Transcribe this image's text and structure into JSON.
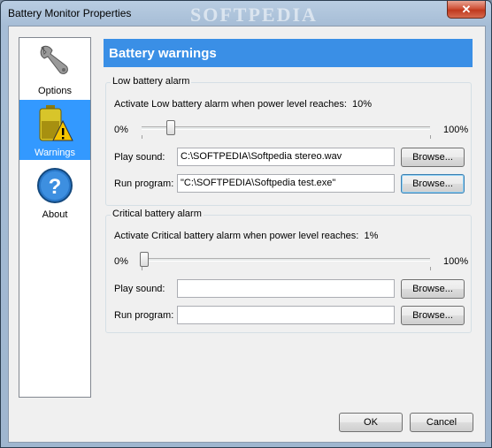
{
  "window": {
    "title": "Battery Monitor Properties",
    "close_glyph": "✕"
  },
  "watermark": "SOFTPEDIA",
  "sidebar": {
    "items": [
      {
        "label": "Options",
        "icon": "wrench-icon",
        "selected": false
      },
      {
        "label": "Warnings",
        "icon": "battery-warning-icon",
        "selected": true
      },
      {
        "label": "About",
        "icon": "help-icon",
        "selected": false
      }
    ]
  },
  "panel": {
    "title": "Battery warnings"
  },
  "low": {
    "group_title": "Low battery alarm",
    "activate_label": "Activate Low battery alarm when power level reaches:",
    "level_value": "10%",
    "level_fraction": 0.1,
    "min_label": "0%",
    "max_label": "100%",
    "sound_label": "Play sound:",
    "sound_value": "C:\\SOFTPEDIA\\Softpedia stereo.wav",
    "program_label": "Run program:",
    "program_value": "\"C:\\SOFTPEDIA\\Softpedia test.exe\"",
    "browse_label": "Browse..."
  },
  "critical": {
    "group_title": "Critical battery alarm",
    "activate_label": "Activate Critical battery alarm when power level reaches:",
    "level_value": "1%",
    "level_fraction": 0.01,
    "min_label": "0%",
    "max_label": "100%",
    "sound_label": "Play sound:",
    "sound_value": "",
    "program_label": "Run program:",
    "program_value": "",
    "browse_label": "Browse..."
  },
  "footer": {
    "ok_label": "OK",
    "cancel_label": "Cancel"
  },
  "colors": {
    "accent": "#3a8fe6",
    "selection": "#3399ff"
  }
}
